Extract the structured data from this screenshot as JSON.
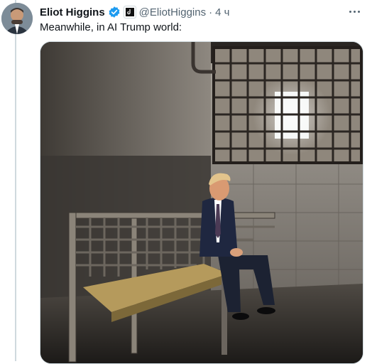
{
  "tweet": {
    "author_name": "Eliot Higgins",
    "handle": "@EliotHiggins",
    "separator": "·",
    "time": "4 ч",
    "text": "Meanwhile, in AI Trump world:",
    "verified_color": "#1d9bf0"
  },
  "media": {
    "type": "photo"
  },
  "icons": {
    "verified": "verified-badge-icon",
    "affiliation": "affiliation-badge-icon",
    "more": "more-dots-icon"
  }
}
